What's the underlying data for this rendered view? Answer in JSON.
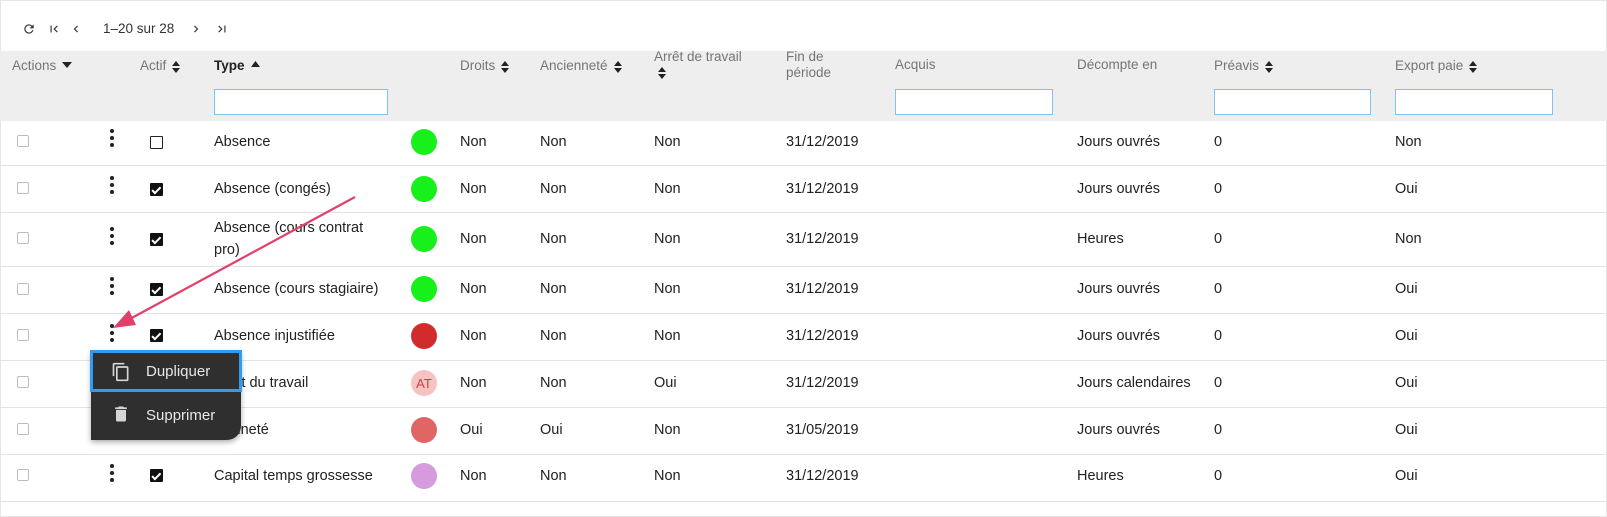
{
  "toolbar": {
    "pager": "1–20 sur 28",
    "refresh_icon": "refresh-icon",
    "first_icon": "first-page-icon",
    "prev_icon": "chevron-left-icon",
    "next_icon": "chevron-right-icon",
    "last_icon": "last-page-icon"
  },
  "columns": {
    "actions": "Actions",
    "actif": "Actif",
    "type": "Type",
    "droits": "Droits",
    "anciennete": "Ancienneté",
    "arret_line1": "Arrêt de travail",
    "fin_line1": "Fin de",
    "fin_line2": "période",
    "acquis": "Acquis",
    "decompte": "Décompte en",
    "preavis": "Préavis",
    "export": "Export paie"
  },
  "rows": [
    {
      "checked": false,
      "type": "Absence",
      "color": "#17f01a",
      "badge": "",
      "droits": "Non",
      "anciennete": "Non",
      "arret": "Non",
      "fin": "31/12/2019",
      "acquis": "",
      "decompte": "Jours ouvrés",
      "preavis": "0",
      "export": "Non"
    },
    {
      "checked": true,
      "type": "Absence (congés)",
      "color": "#17f01a",
      "badge": "",
      "droits": "Non",
      "anciennete": "Non",
      "arret": "Non",
      "fin": "31/12/2019",
      "acquis": "",
      "decompte": "Jours ouvrés",
      "preavis": "0",
      "export": "Oui"
    },
    {
      "checked": true,
      "type_line1": "Absence (cours contrat",
      "type_line2": "pro)",
      "color": "#17f01a",
      "badge": "",
      "droits": "Non",
      "anciennete": "Non",
      "arret": "Non",
      "fin": "31/12/2019",
      "acquis": "",
      "decompte": "Heures",
      "preavis": "0",
      "export": "Non"
    },
    {
      "checked": true,
      "type": "Absence (cours stagiaire)",
      "color": "#17f01a",
      "badge": "",
      "droits": "Non",
      "anciennete": "Non",
      "arret": "Non",
      "fin": "31/12/2019",
      "acquis": "",
      "decompte": "Jours ouvrés",
      "preavis": "0",
      "export": "Oui"
    },
    {
      "checked": true,
      "type": "Absence injustifiée",
      "color": "#d22b2b",
      "badge": "",
      "droits": "Non",
      "anciennete": "Non",
      "arret": "Non",
      "fin": "31/12/2019",
      "acquis": "",
      "decompte": "Jours ouvrés",
      "preavis": "0",
      "export": "Oui"
    },
    {
      "checked": true,
      "type": "ident du travail",
      "color": "#f6c3c3",
      "badge": "AT",
      "droits": "Non",
      "anciennete": "Non",
      "arret": "Oui",
      "fin": "31/12/2019",
      "acquis": "",
      "decompte": "Jours calendaires",
      "preavis": "0",
      "export": "Oui"
    },
    {
      "checked": true,
      "type": "cienneté",
      "color": "#e06666",
      "badge": "",
      "droits": "Oui",
      "anciennete": "Oui",
      "arret": "Non",
      "fin": "31/05/2019",
      "acquis": "",
      "decompte": "Jours ouvrés",
      "preavis": "0",
      "export": "Oui"
    },
    {
      "checked": true,
      "type": "Capital temps grossesse",
      "color": "#d69ade",
      "badge": "",
      "droits": "Non",
      "anciennete": "Non",
      "arret": "Non",
      "fin": "31/12/2019",
      "acquis": "",
      "decompte": "Heures",
      "preavis": "0",
      "export": "Oui"
    }
  ],
  "menu": {
    "duplicate_label": "Dupliquer",
    "delete_label": "Supprimer",
    "duplicate_icon": "copy-icon",
    "delete_icon": "trash-icon"
  },
  "colors": {
    "header_bg": "#eeeeee",
    "filter_border": "#7ec3e8",
    "menu_bg": "#2f2f2f",
    "menu_highlight": "#2e9cf2",
    "annotation_arrow": "#e0406a"
  }
}
